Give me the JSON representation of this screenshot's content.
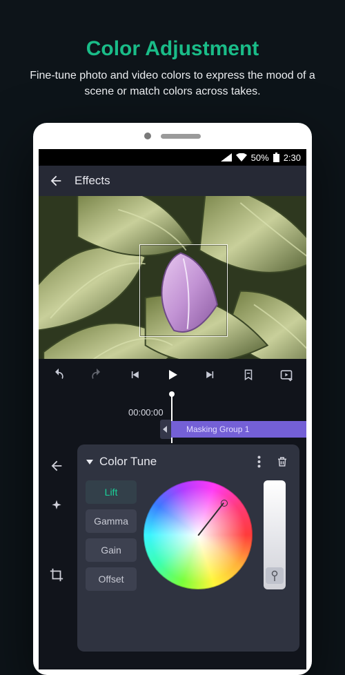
{
  "hero": {
    "title": "Color Adjustment",
    "subtitle": "Fine-tune photo and video colors to express the mood of a scene or match colors across takes."
  },
  "statusbar": {
    "battery_pct": "50%",
    "clock": "2:30"
  },
  "header": {
    "title": "Effects"
  },
  "timeline": {
    "timecode": "00:00:00",
    "clip_label": "Masking Group 1"
  },
  "panel": {
    "title": "Color Tune",
    "params": [
      "Lift",
      "Gamma",
      "Gain",
      "Offset"
    ],
    "active_param": "Lift"
  }
}
